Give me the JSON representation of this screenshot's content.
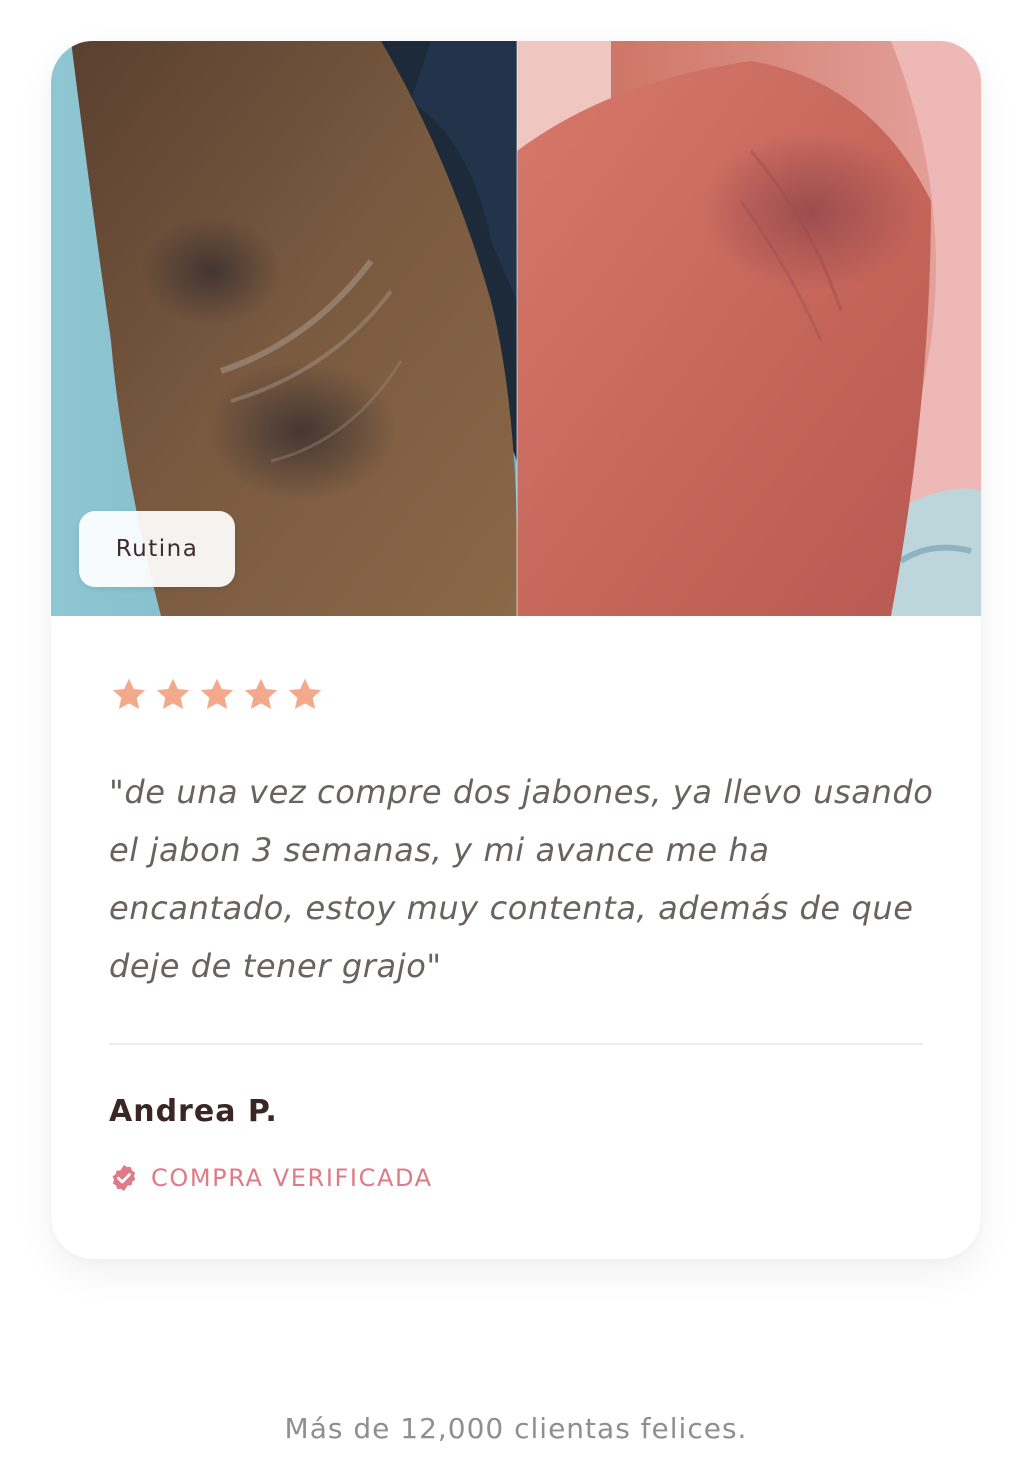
{
  "testimonial": {
    "photo_description_icon": "before-after-photo",
    "tag_label": "Rutina",
    "rating": 5,
    "rating_max": 5,
    "star_color": "#f5a98c",
    "quote": "\"de una vez compre dos jabones, ya llevo usando el jabon 3 semanas, y mi avance me ha encantado, estoy muy contenta, además de que deje de tener grajo\"",
    "author": "Andrea P.",
    "verified_icon": "verified-badge-icon",
    "verified_label": "COMPRA VERIFICADA",
    "accent_color": "#e07a86"
  },
  "footer": {
    "text": "Más de 12,000 clientas felices."
  }
}
